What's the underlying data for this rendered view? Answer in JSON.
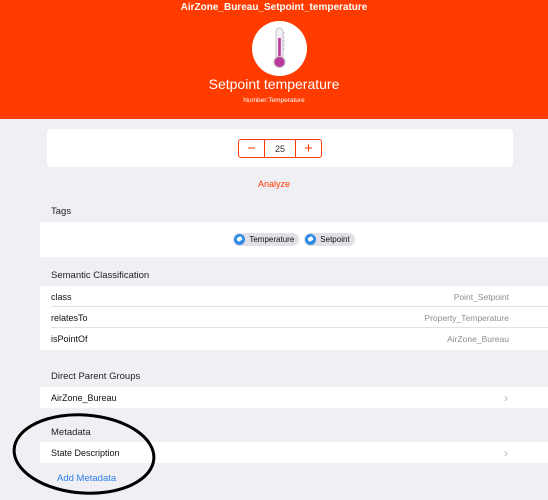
{
  "header": {
    "title": "AirZone_Bureau_Setpoint_temperature",
    "name": "Setpoint temperature",
    "type": "Number:Temperature",
    "icon": "thermometer-icon",
    "color": "#ff3b00"
  },
  "stepper": {
    "minus": "−",
    "value": "25",
    "plus": "+"
  },
  "analyze": "Analyze",
  "tags": {
    "label": "Tags",
    "items": [
      "Temperature",
      "Setpoint"
    ]
  },
  "semantic": {
    "label": "Semantic Classification",
    "rows": [
      {
        "key": "class",
        "value": "Point_Setpoint"
      },
      {
        "key": "relatesTo",
        "value": "Property_Temperature"
      },
      {
        "key": "isPointOf",
        "value": "AirZone_Bureau"
      }
    ]
  },
  "parents": {
    "label": "Direct Parent Groups",
    "items": [
      "AirZone_Bureau"
    ]
  },
  "metadata": {
    "label": "Metadata",
    "items": [
      "State Description"
    ],
    "add": "Add Metadata"
  }
}
